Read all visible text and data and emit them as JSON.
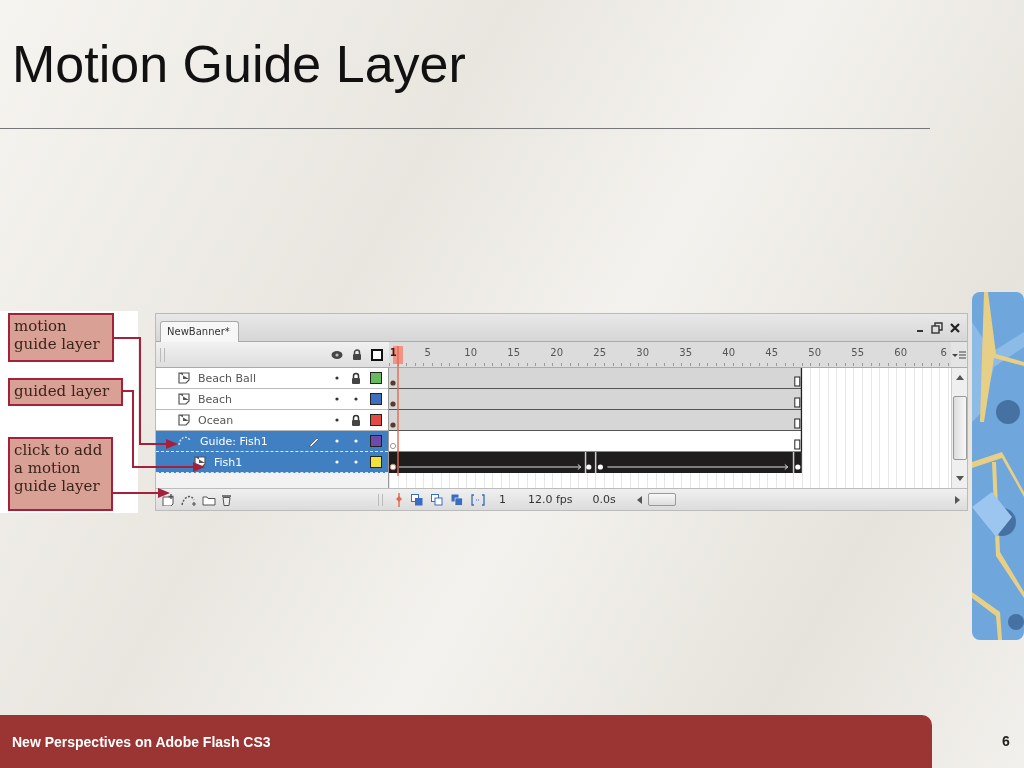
{
  "slide": {
    "title": "Motion Guide Layer",
    "footer": "New Perspectives on Adobe Flash CS3",
    "page_number": "6"
  },
  "callouts": [
    {
      "text": "motion guide layer",
      "kind": "guide"
    },
    {
      "text": "guided layer",
      "kind": "guided"
    },
    {
      "text": "click to add a motion guide layer",
      "kind": "addguide"
    }
  ],
  "timeline": {
    "tab": "NewBanner*",
    "ruler": [
      "1",
      "5",
      "10",
      "15",
      "20",
      "25",
      "30",
      "35",
      "40",
      "45",
      "50",
      "55",
      "60",
      "6"
    ],
    "layers": [
      {
        "name": "Beach Ball",
        "kind": "normal",
        "selected": false,
        "locked": true,
        "editing": false,
        "color": "#66bb5e"
      },
      {
        "name": "Beach",
        "kind": "normal",
        "selected": false,
        "locked": false,
        "editing": false,
        "color": "#3d6fbf"
      },
      {
        "name": "Ocean",
        "kind": "normal",
        "selected": false,
        "locked": true,
        "editing": false,
        "color": "#e04c44"
      },
      {
        "name": "Guide: Fish1",
        "kind": "guide",
        "selected": true,
        "locked": false,
        "editing": true,
        "color": "#6e4aa8"
      },
      {
        "name": "Fish1",
        "kind": "guided",
        "selected": true,
        "locked": false,
        "editing": false,
        "color": "#f2e23a"
      }
    ],
    "status": {
      "frame": "1",
      "rate": "12.0 fps",
      "time": "0.0s"
    }
  }
}
